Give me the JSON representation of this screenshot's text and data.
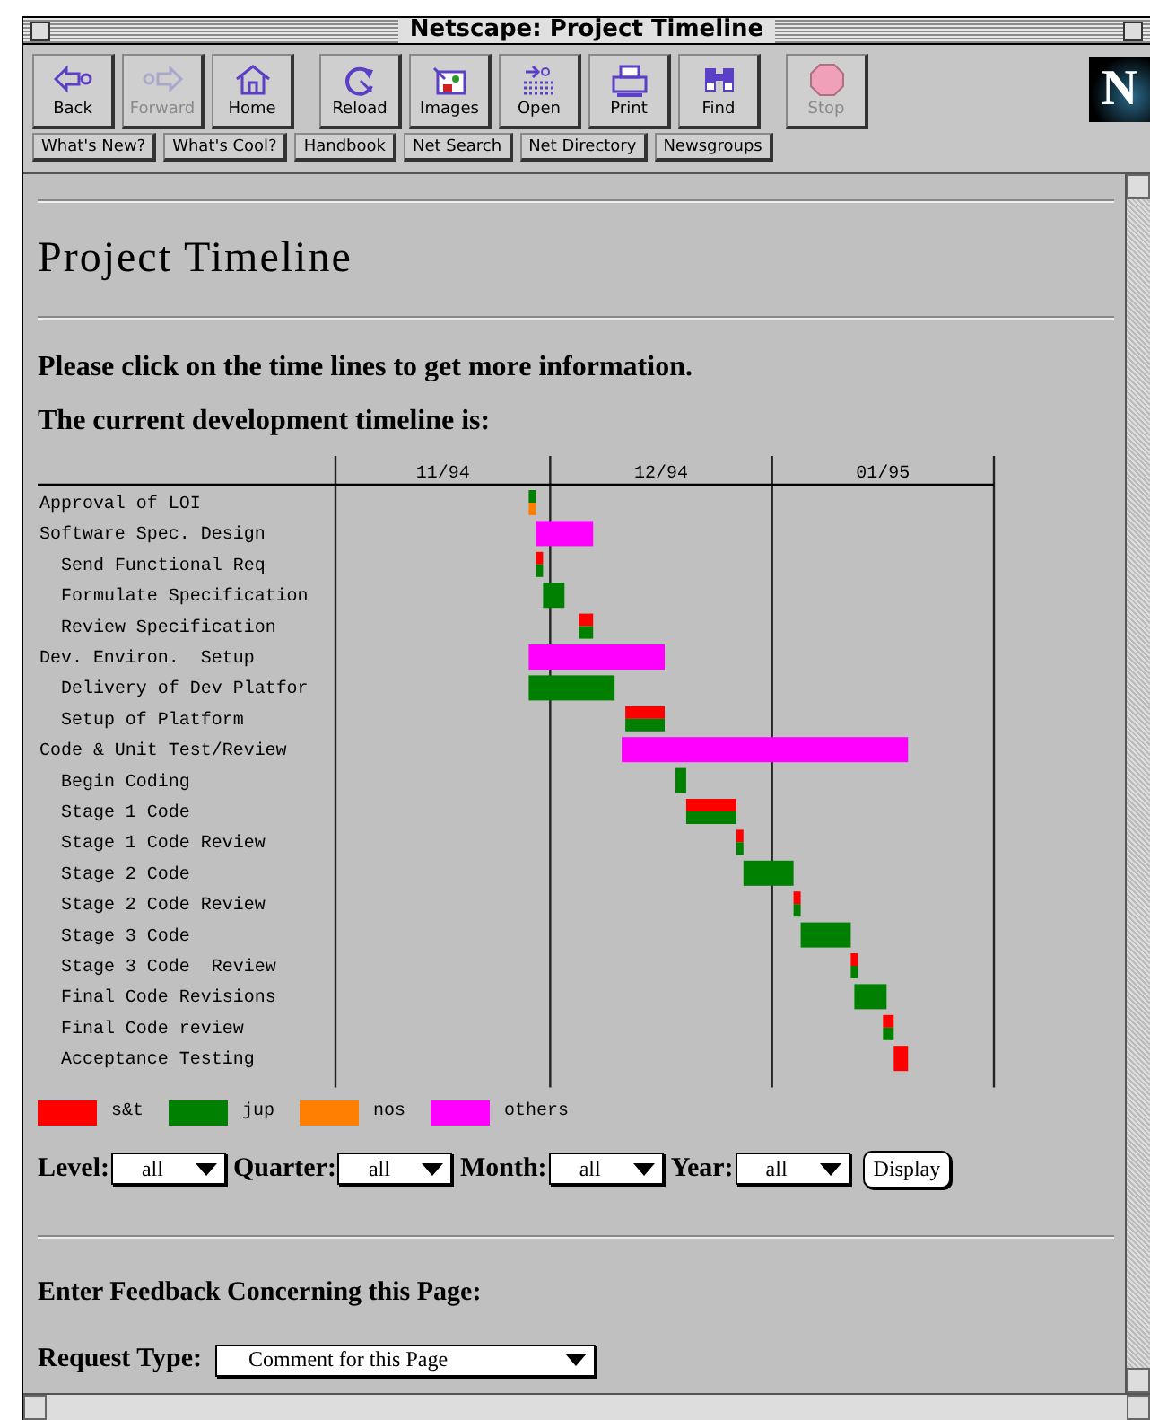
{
  "window": {
    "title": "Netscape: Project Timeline"
  },
  "toolbar": {
    "buttons": [
      {
        "kind": "back",
        "label": "Back",
        "disabled": false
      },
      {
        "kind": "forward",
        "label": "Forward",
        "disabled": true
      },
      {
        "kind": "home",
        "label": "Home",
        "disabled": false
      },
      {
        "kind": "reload",
        "label": "Reload",
        "disabled": false
      },
      {
        "kind": "images",
        "label": "Images",
        "disabled": false
      },
      {
        "kind": "open",
        "label": "Open",
        "disabled": false
      },
      {
        "kind": "print",
        "label": "Print",
        "disabled": false
      },
      {
        "kind": "find",
        "label": "Find",
        "disabled": false
      },
      {
        "kind": "stop",
        "label": "Stop",
        "disabled": true
      }
    ],
    "logo": "N"
  },
  "directory_buttons": [
    "What's New?",
    "What's Cool?",
    "Handbook",
    "Net Search",
    "Net Directory",
    "Newsgroups"
  ],
  "page": {
    "heading": "Project Timeline",
    "instruction": "Please click on the time lines to get more information.",
    "subheading": "The current development timeline is:",
    "timeline": {
      "months": [
        "11/94",
        "12/94",
        "01/95"
      ],
      "tasks": [
        {
          "label": "Approval of LOI"
        },
        {
          "label": "Software Spec. Design",
          "children": [
            {
              "label": "Send Functional Req"
            },
            {
              "label": "Formulate Specification"
            },
            {
              "label": "Review Specification"
            }
          ]
        },
        {
          "label": "Dev. Environ.  Setup",
          "children": [
            {
              "label": "Delivery of Dev Platfor"
            },
            {
              "label": "Setup of Platform"
            }
          ]
        },
        {
          "label": "Code & Unit Test/Review",
          "children": [
            {
              "label": "Begin Coding"
            },
            {
              "label": "Stage 1 Code"
            },
            {
              "label": "Stage 1 Code Review"
            },
            {
              "label": "Stage 2 Code"
            },
            {
              "label": "Stage 2 Code Review"
            },
            {
              "label": "Stage 3 Code"
            },
            {
              "label": "Stage 3 Code  Review"
            },
            {
              "label": "Final Code Revisions"
            },
            {
              "label": "Final Code review"
            },
            {
              "label": "Acceptance Testing"
            }
          ]
        }
      ],
      "legend": [
        {
          "name": "s&t",
          "color": "#ff0000"
        },
        {
          "name": "jup",
          "color": "#008000"
        },
        {
          "name": "nos",
          "color": "#ff8000"
        },
        {
          "name": "others",
          "color": "#ff00ff"
        }
      ]
    },
    "filters": [
      {
        "label": "Level:",
        "value": "all"
      },
      {
        "label": "Quarter:",
        "value": "all"
      },
      {
        "label": "Month:",
        "value": "all"
      },
      {
        "label": "Year:",
        "value": "all"
      }
    ],
    "display_button": "Display",
    "feedback_heading": "Enter Feedback Concerning this Page:",
    "request_type": {
      "label": "Request Type:",
      "value": "Comment for this Page"
    }
  }
}
